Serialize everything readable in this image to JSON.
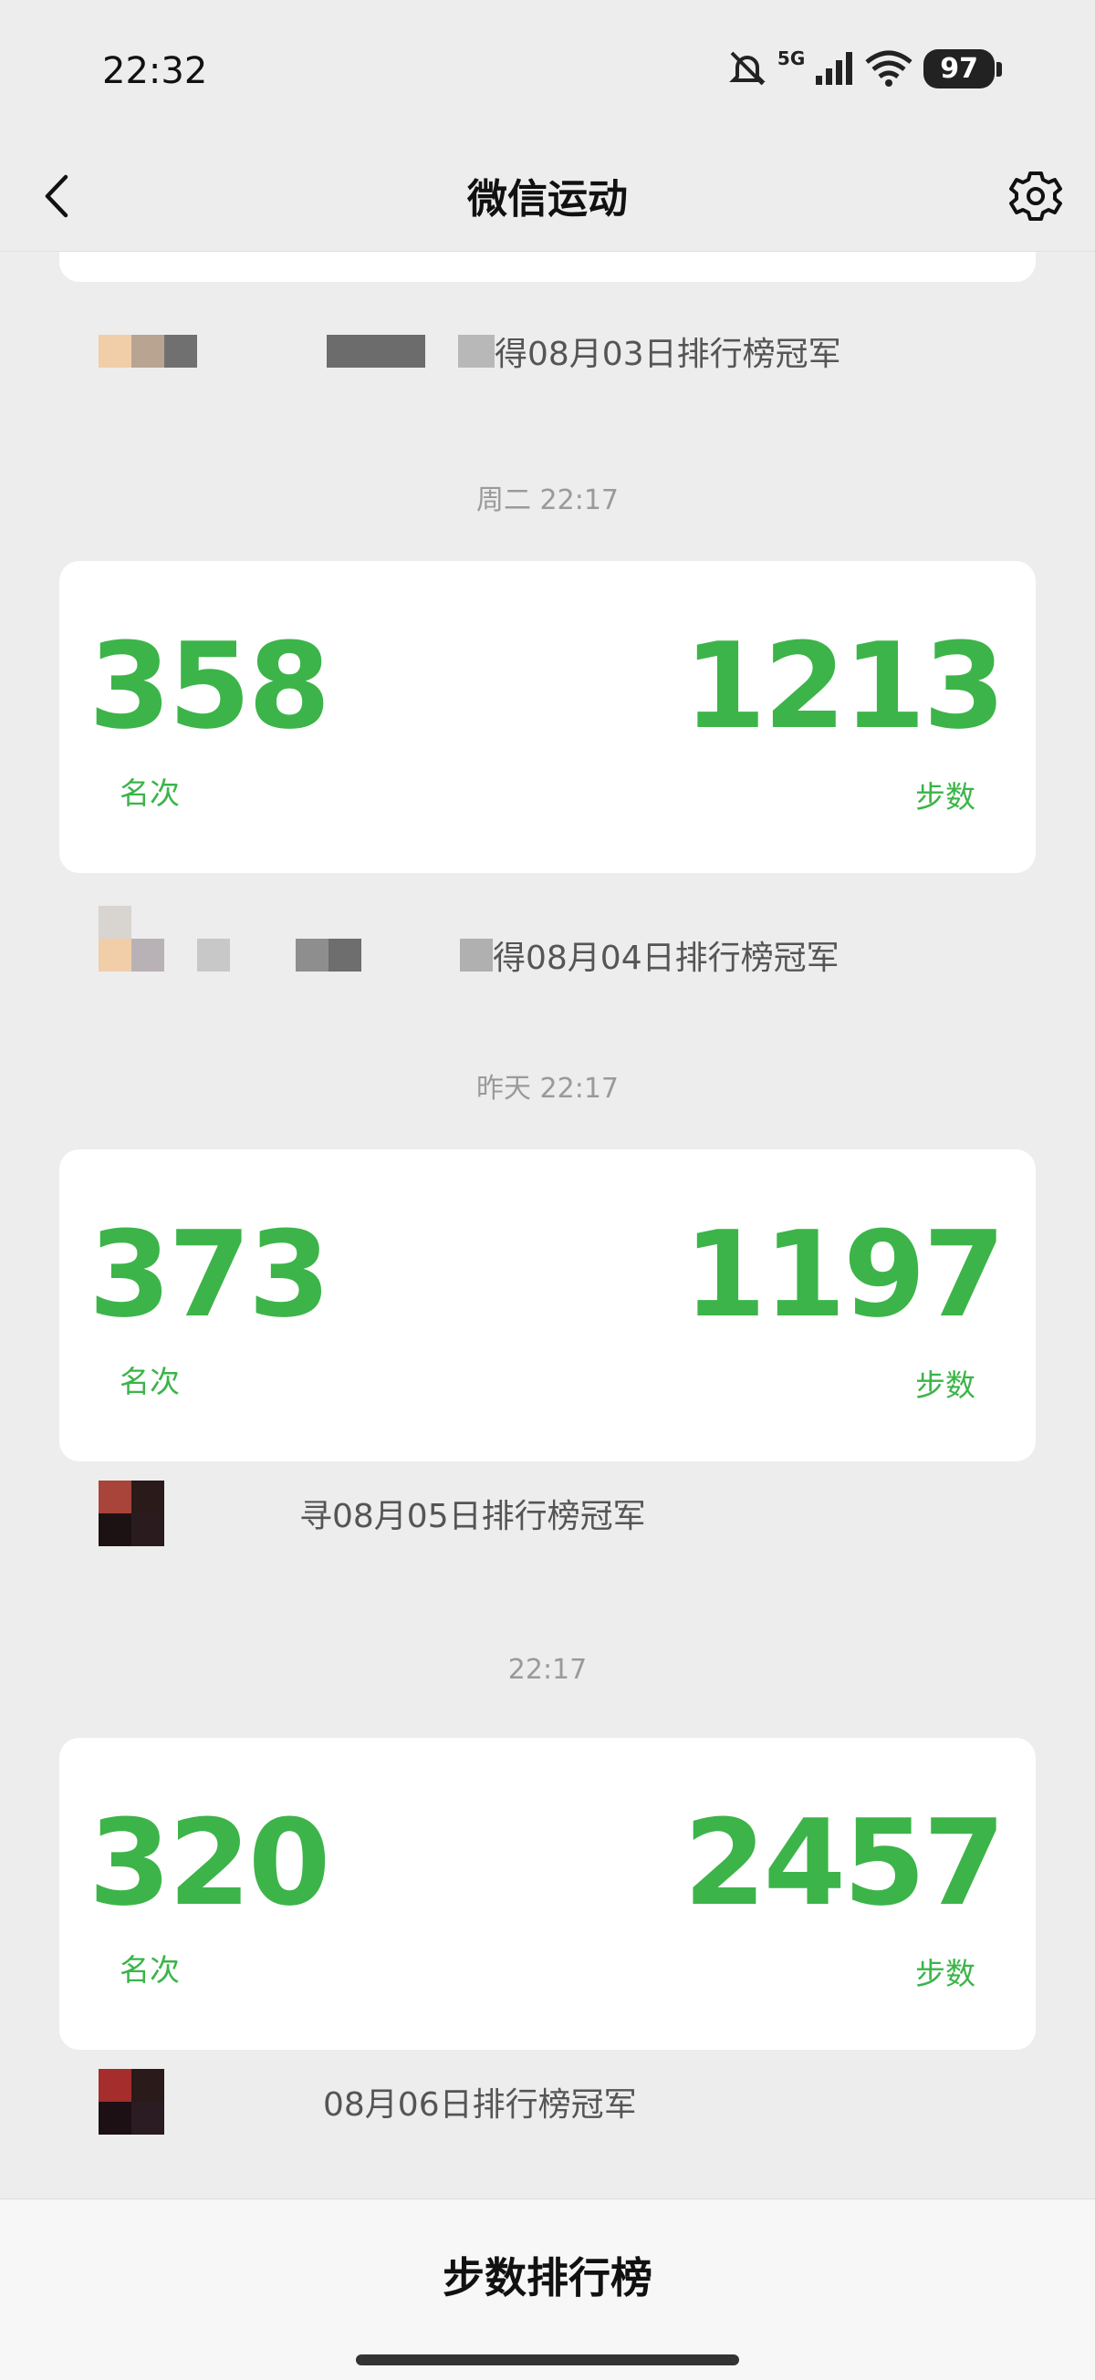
{
  "status": {
    "time": "22:32",
    "network": "5G",
    "battery": "97"
  },
  "nav": {
    "title": "微信运动"
  },
  "entries": [
    {
      "champion_text": "得08月03日排行榜冠军"
    },
    {
      "time": "周二 22:17",
      "rank": "358",
      "rank_label": "名次",
      "steps": "1213",
      "steps_label": "步数",
      "champion_text": "得08月04日排行榜冠军"
    },
    {
      "time": "昨天 22:17",
      "rank": "373",
      "rank_label": "名次",
      "steps": "1197",
      "steps_label": "步数",
      "champion_text": "寻08月05日排行榜冠军"
    },
    {
      "time": "22:17",
      "rank": "320",
      "rank_label": "名次",
      "steps": "2457",
      "steps_label": "步数",
      "champion_text": "08月06日排行榜冠军"
    }
  ],
  "bottom": {
    "title": "步数排行榜"
  },
  "colors": {
    "accent": "#3cb449",
    "background": "#ededed"
  }
}
